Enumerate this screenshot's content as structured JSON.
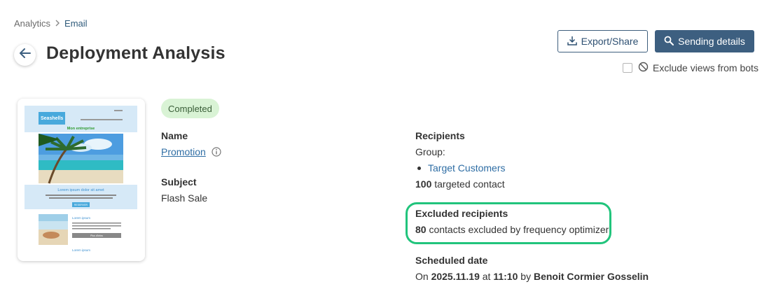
{
  "breadcrumb": {
    "items": [
      "Analytics",
      "Email"
    ]
  },
  "page": {
    "title": "Deployment Analysis"
  },
  "actions": {
    "export_label": "Export/Share",
    "sending_label": "Sending details"
  },
  "exclude_bots": {
    "label": "Exclude views from bots",
    "checked": false
  },
  "status": "Completed",
  "name": {
    "label": "Name",
    "value": "Promotion"
  },
  "subject": {
    "label": "Subject",
    "value": "Flash Sale"
  },
  "recipients": {
    "label": "Recipients",
    "group_label": "Group:",
    "groups": [
      "Target Customers"
    ],
    "count": "100",
    "count_suffix": "targeted contact"
  },
  "excluded": {
    "label": "Excluded recipients",
    "count": "80",
    "suffix": "contacts excluded by frequency optimizer"
  },
  "scheduled": {
    "label": "Scheduled date",
    "prefix": "On",
    "date": "2025.11.19",
    "at": "at",
    "time": "11:10",
    "by": "by",
    "author": "Benoit Cormier Gosselin"
  },
  "thumbnail": {
    "brand": "Seashells",
    "heading": "Mon entreprise",
    "lorem_heading": "Lorem ipsum dolor sit amet",
    "button": "RESERVER",
    "article_title": "Lorem ipsum",
    "more_button": "Plus d'infos",
    "footer_title": "Lorem ipsum"
  },
  "colors": {
    "primary": "#3d5f80",
    "link": "#2e6da4",
    "badge_bg": "#d9f3d5",
    "highlight": "#21c47c"
  }
}
